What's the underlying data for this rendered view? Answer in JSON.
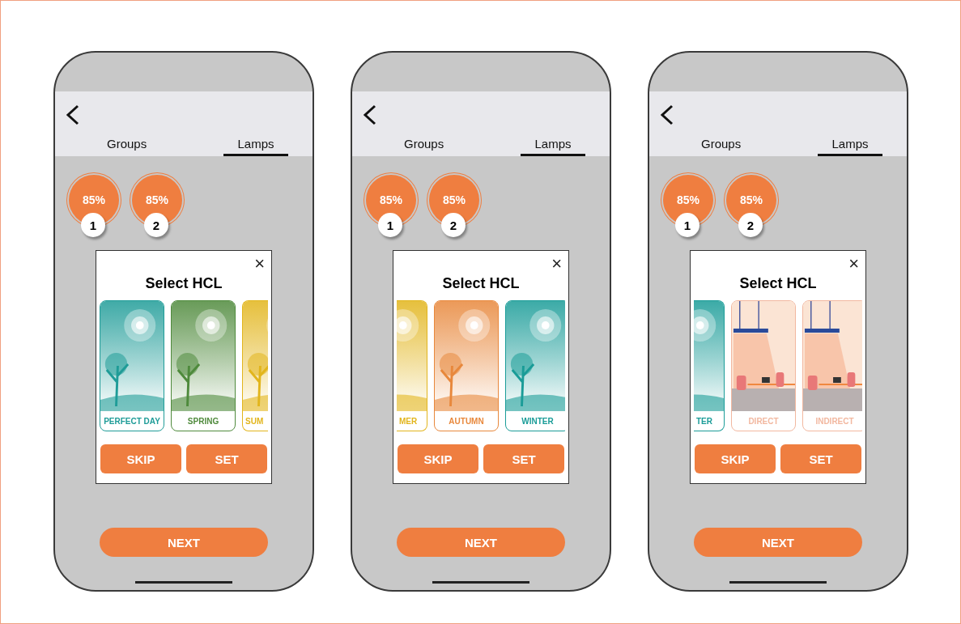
{
  "screens": [
    {
      "tabs": [
        {
          "label": "Groups",
          "selected": false
        },
        {
          "label": "Lamps",
          "selected": true
        }
      ],
      "lamps": [
        {
          "value": "85%",
          "number": "1"
        },
        {
          "value": "85%",
          "number": "2"
        }
      ],
      "dialog": {
        "title": "Select HCL",
        "close": "×",
        "cards": [
          {
            "kind": "season",
            "label": "PERFECT DAY",
            "color": "#1f9c98",
            "partial": false
          },
          {
            "kind": "season",
            "label": "SPRING",
            "color": "#4f8a3c",
            "partial": false
          },
          {
            "kind": "season",
            "label": "SUM",
            "color": "#e2b51c",
            "partial": true
          }
        ],
        "buttons": [
          "SKIP",
          "SET"
        ]
      },
      "next": "NEXT"
    },
    {
      "tabs": [
        {
          "label": "Groups",
          "selected": false
        },
        {
          "label": "Lamps",
          "selected": true
        }
      ],
      "lamps": [
        {
          "value": "85%",
          "number": "1"
        },
        {
          "value": "85%",
          "number": "2"
        }
      ],
      "dialog": {
        "title": "Select HCL",
        "close": "×",
        "cards": [
          {
            "kind": "season",
            "label": "MER",
            "color": "#e2b51c",
            "partial": true
          },
          {
            "kind": "season",
            "label": "AUTUMN",
            "color": "#e8883c",
            "partial": false
          },
          {
            "kind": "season",
            "label": "WINTER",
            "color": "#1a9c98",
            "partial": false
          }
        ],
        "buttons": [
          "SKIP",
          "SET"
        ]
      },
      "next": "NEXT"
    },
    {
      "tabs": [
        {
          "label": "Groups",
          "selected": false
        },
        {
          "label": "Lamps",
          "selected": true
        }
      ],
      "lamps": [
        {
          "value": "85%",
          "number": "1"
        },
        {
          "value": "85%",
          "number": "2"
        }
      ],
      "dialog": {
        "title": "Select HCL",
        "close": "×",
        "cards": [
          {
            "kind": "season",
            "label": "TER",
            "color": "#1a9c98",
            "partial": true
          },
          {
            "kind": "office",
            "label": "DIRECT",
            "color": "#f2b8a0",
            "partial": false
          },
          {
            "kind": "office",
            "label": "INDIRECT",
            "color": "#f2b8a0",
            "partial": false
          }
        ],
        "buttons": [
          "SKIP",
          "SET"
        ]
      },
      "next": "NEXT"
    }
  ]
}
